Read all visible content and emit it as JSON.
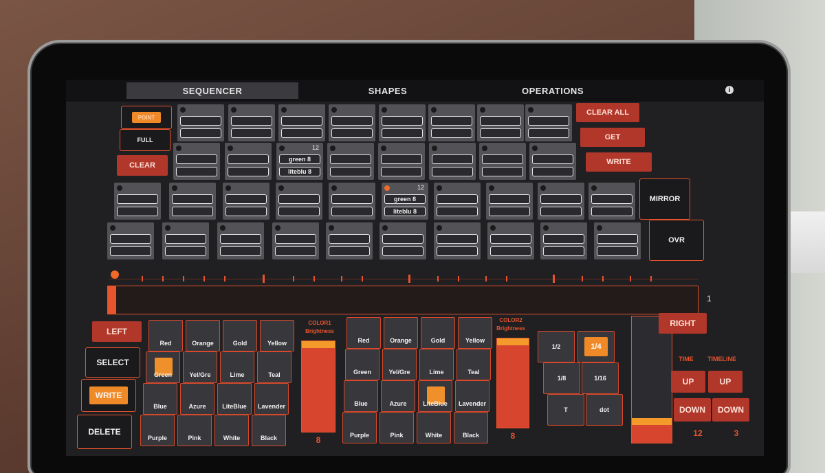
{
  "tabs": [
    "SEQUENCER",
    "SHAPES",
    "OPERATIONS"
  ],
  "info_icon": "i",
  "left_buttons": {
    "point": "POINT",
    "full": "FULL",
    "clear": "CLEAR"
  },
  "right_buttons": {
    "clear_all": "CLEAR ALL",
    "get": "GET",
    "write": "WRITE",
    "mirror": "MIRROR",
    "ovr": "OVR"
  },
  "cells": {
    "r2c3": {
      "num": "12",
      "s1": "green 8",
      "s2": "liteblu 8"
    },
    "r3c6": {
      "num": "12",
      "s1": "green 8",
      "s2": "liteblu 8"
    }
  },
  "timeline": {
    "position": "1"
  },
  "controls": {
    "left": "LEFT",
    "right": "RIGHT",
    "select": "SELECT",
    "write": "WRITE",
    "delete": "DELETE"
  },
  "color1": {
    "label": "COLOR1",
    "sub": "Brightness",
    "value": "8"
  },
  "color2": {
    "label": "COLOR2",
    "sub": "Brightness",
    "value": "8"
  },
  "colors": [
    "Red",
    "Orange",
    "Gold",
    "Yellow",
    "Green",
    "Yel/Gre",
    "Lime",
    "Teal",
    "Blue",
    "Azure",
    "LiteBlue",
    "Lavender",
    "Purple",
    "Pink",
    "White",
    "Black"
  ],
  "note_values": [
    "1/2",
    "1/4",
    "1/8",
    "1/16",
    "T",
    "dot"
  ],
  "time": {
    "label": "TIME",
    "up": "UP",
    "down": "DOWN",
    "value": "12"
  },
  "timeline_ctrl": {
    "label": "TIMELINE",
    "up": "UP",
    "down": "DOWN",
    "value": "3"
  },
  "colors_hex": {
    "accent": "#e8542e",
    "button_red": "#b2372b",
    "selected": "#f08a28",
    "cell_gray": "#525257"
  }
}
